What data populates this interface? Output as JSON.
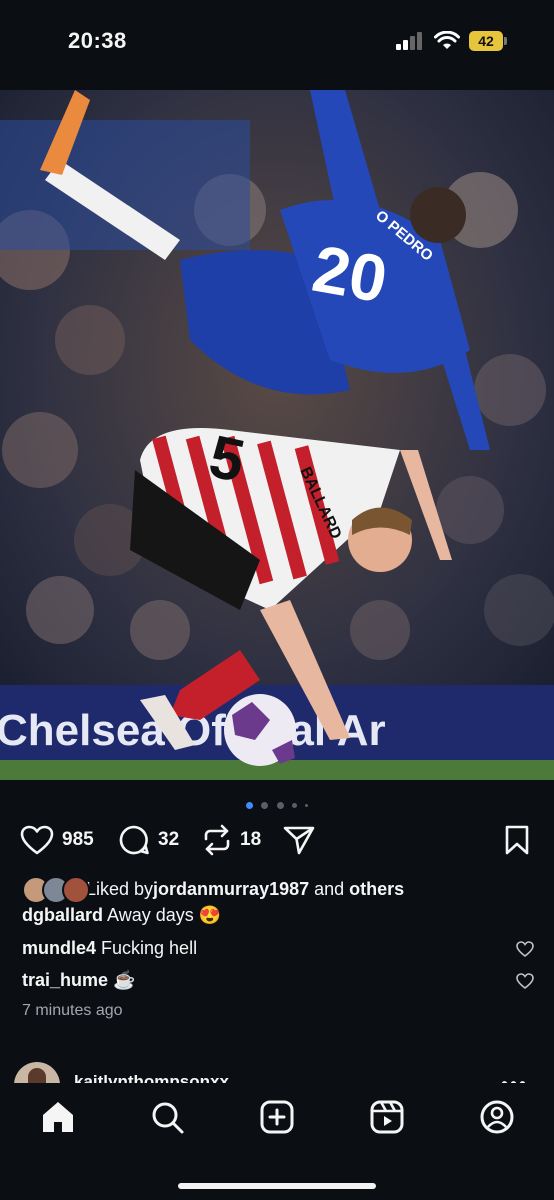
{
  "status_bar": {
    "time": "20:38",
    "battery": "42"
  },
  "photo": {
    "banner_text": "Chelsea Official Ar",
    "player_top_name": "O PEDRO",
    "player_top_number": "20",
    "player_bottom_name": "BALLARD",
    "player_bottom_number": "5"
  },
  "carousel": {
    "count": 5,
    "active_index": 0
  },
  "actions": {
    "likes": "985",
    "comments": "32",
    "reposts": "18"
  },
  "liked_by": {
    "prefix": "Liked by ",
    "user": "jordanmurray1987",
    "middle": " and ",
    "others": "others"
  },
  "caption": {
    "user": "dgballard",
    "text": " Away days 😍"
  },
  "comments": [
    {
      "user": "mundle4",
      "text": " Fucking hell"
    },
    {
      "user": "trai_hume",
      "text": " ☕"
    }
  ],
  "timestamp": "7 minutes ago",
  "next_post": {
    "username": "kaitlynthompsonxx"
  },
  "colors": {
    "accent": "#3f8cff",
    "background": "#0b0f14",
    "battery": "#e6c53d"
  },
  "nav": [
    "home-icon",
    "search-icon",
    "create-icon",
    "reels-icon",
    "profile-icon"
  ]
}
